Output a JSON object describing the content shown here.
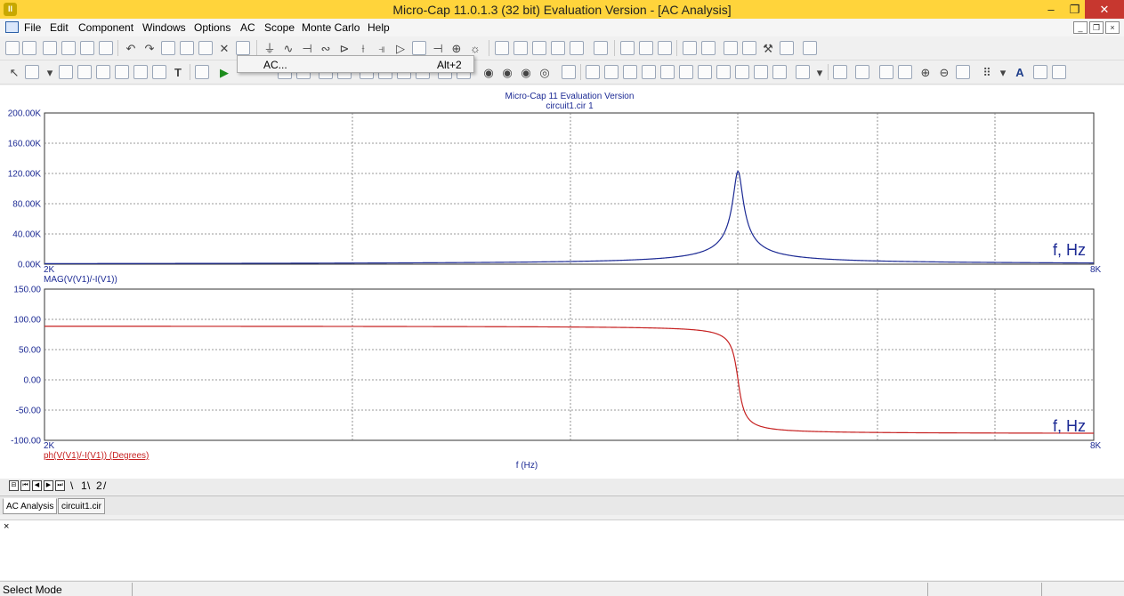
{
  "window": {
    "title": "Micro-Cap 11.0.1.3 (32 bit) Evaluation Version - [AC Analysis]",
    "app_icon_text": "II",
    "min_glyph": "–",
    "restore_glyph": "❐",
    "close_glyph": "✕"
  },
  "menu": {
    "items": [
      "File",
      "Edit",
      "Component",
      "Windows",
      "Options",
      "AC",
      "Scope",
      "Monte Carlo",
      "Help"
    ],
    "mdi_buttons": [
      "_",
      "❐",
      "×"
    ]
  },
  "dropdown": {
    "label": "AC...",
    "shortcut": "Alt+2"
  },
  "plot": {
    "header_line1": "Micro-Cap 11 Evaluation Version",
    "header_line2": "circuit1.cir 1",
    "xlabel": "f (Hz)",
    "axis_unit_label": "f, Hz",
    "x_min_label": "2K",
    "x_max_label": "8K"
  },
  "chart_data": [
    {
      "type": "line",
      "series": [
        {
          "name": "MAG(V(V1)/-I(V1))",
          "color": "#1c2a94"
        }
      ],
      "yticks": [
        "200.00K",
        "160.00K",
        "120.00K",
        "80.00K",
        "40.00K",
        "0.00K"
      ],
      "ylim": [
        0,
        200000
      ],
      "xlim": [
        2000,
        8000
      ],
      "x_scale": "log",
      "grid": true,
      "peak": {
        "x": 5000,
        "y": 123000
      }
    },
    {
      "type": "line",
      "series": [
        {
          "name": "ph(V(V1)/-I(V1)) (Degrees)",
          "color": "#c62121"
        }
      ],
      "yticks": [
        "150.00",
        "100.00",
        "50.00",
        "0.00",
        "-50.00",
        "-100.00"
      ],
      "ylim": [
        -100,
        150
      ],
      "xlim": [
        2000,
        8000
      ],
      "x_scale": "log",
      "grid": true,
      "start_value": 89,
      "end_value": -89
    }
  ],
  "pages": {
    "tab1": "1",
    "tab2": "2"
  },
  "doc_tabs": [
    "AC Analysis",
    "circuit1.cir"
  ],
  "output": {
    "close_glyph": "×"
  },
  "status": {
    "text": "Select Mode"
  }
}
